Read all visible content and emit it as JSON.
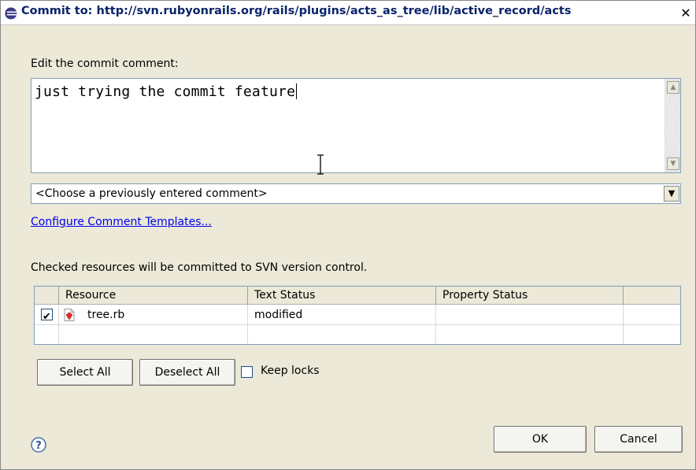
{
  "window": {
    "title": "Commit to: http://svn.rubyonrails.org/rails/plugins/acts_as_tree/lib/active_record/acts",
    "close_symbol": "✕",
    "icon": "eclipse-icon"
  },
  "comment": {
    "label": "Edit the commit comment:",
    "value": "just trying the commit feature",
    "history_placeholder": "<Choose a previously entered comment>",
    "configure_link": "Configure Comment Templates..."
  },
  "resources": {
    "description": "Checked resources will be committed to SVN version control.",
    "columns": [
      "Resource",
      "Text Status",
      "Property Status"
    ],
    "rows": [
      {
        "checked": true,
        "name": "tree.rb",
        "text_status": "modified",
        "property_status": "",
        "icon": "ruby-file-icon"
      }
    ]
  },
  "actions": {
    "select_all": "Select All",
    "deselect_all": "Deselect All",
    "keep_locks": "Keep locks",
    "keep_locks_checked": false
  },
  "footer": {
    "ok": "OK",
    "cancel": "Cancel",
    "help_icon": "help-icon"
  }
}
